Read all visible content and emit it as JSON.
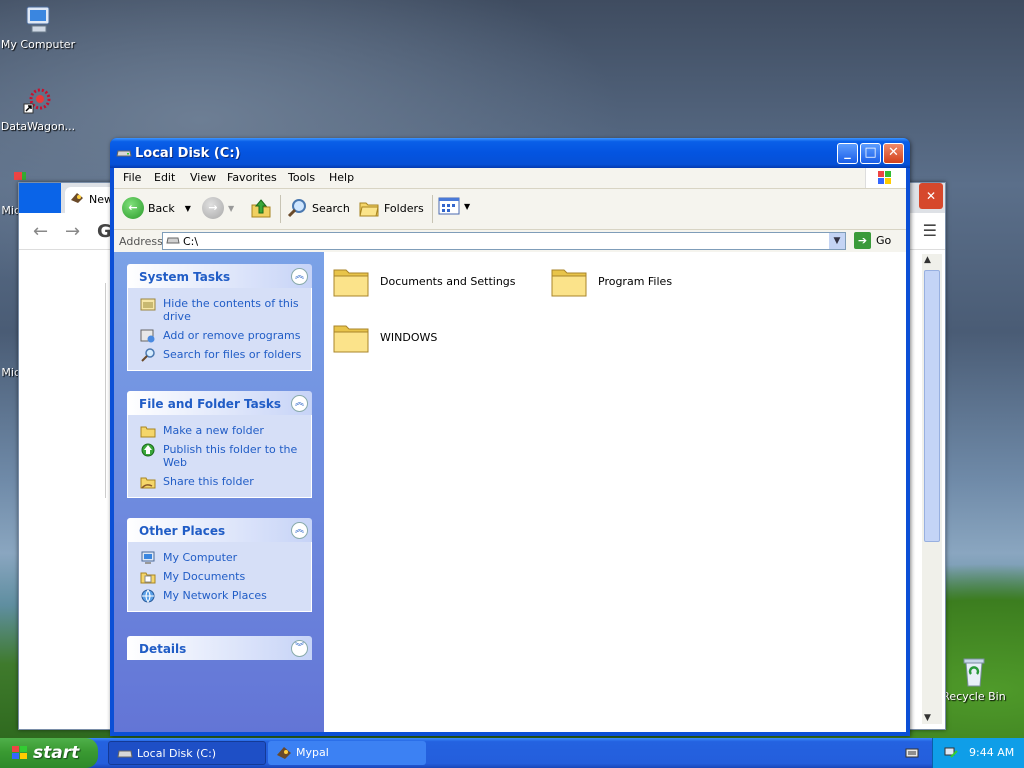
{
  "desktop": {
    "icons": [
      {
        "label": "My Computer"
      },
      {
        "label": "DataWagon..."
      },
      {
        "label": "Mic"
      },
      {
        "label": "Mic"
      },
      {
        "label": "Recycle Bin"
      }
    ]
  },
  "browser": {
    "tab_label": "New",
    "letter": "G"
  },
  "explorer": {
    "title": "Local Disk (C:)",
    "menu": [
      "File",
      "Edit",
      "View",
      "Favorites",
      "Tools",
      "Help"
    ],
    "toolbar": {
      "back": "Back",
      "search": "Search",
      "folders": "Folders"
    },
    "address": {
      "label": "Address",
      "value": "C:\\",
      "go": "Go"
    },
    "panels": {
      "system_tasks": {
        "title": "System Tasks",
        "links": [
          "Hide the contents of this drive",
          "Add or remove programs",
          "Search for files or folders"
        ]
      },
      "file_folder_tasks": {
        "title": "File and Folder Tasks",
        "links": [
          "Make a new folder",
          "Publish this folder to the Web",
          "Share this folder"
        ]
      },
      "other_places": {
        "title": "Other Places",
        "links": [
          "My Computer",
          "My Documents",
          "My Network Places"
        ]
      },
      "details": {
        "title": "Details"
      }
    },
    "items": [
      "Documents and Settings",
      "Program Files",
      "WINDOWS"
    ]
  },
  "taskbar": {
    "start_label": "start",
    "tasks": [
      "Local Disk (C:)",
      "Mypal"
    ],
    "clock": "9:44 AM"
  },
  "colors": {
    "title_blue": "#0454e0",
    "link_blue": "#215dc6",
    "start_green": "#3a9a32"
  }
}
